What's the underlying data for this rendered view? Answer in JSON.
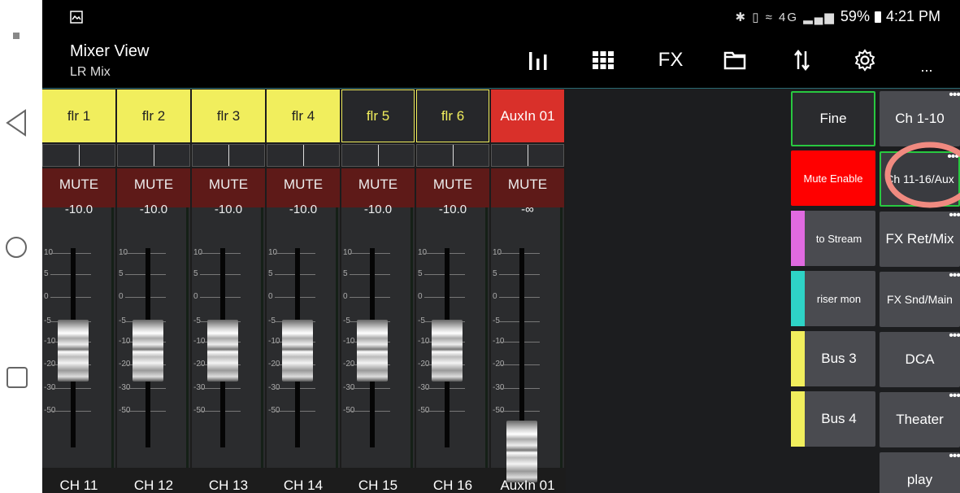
{
  "status_bar": {
    "battery": "59%",
    "time": "4:21 PM",
    "icons": "✱ ▯ ≈ 4G ▂▄▆"
  },
  "app_bar": {
    "title": "Mixer View",
    "subtitle": "LR Mix",
    "fx_label": "FX",
    "more_label": "..."
  },
  "fader_scale": [
    "10",
    "5",
    "0",
    "-5",
    "-10",
    "-20",
    "-30",
    "-50"
  ],
  "channels": [
    {
      "scribble": "flr 1",
      "mute": "MUTE",
      "db": "-10.0",
      "name": "CH 11",
      "color": "#f1ee5d",
      "text_color": "#222222",
      "outlined": false,
      "level": 0.56
    },
    {
      "scribble": "flr 2",
      "mute": "MUTE",
      "db": "-10.0",
      "name": "CH 12",
      "color": "#f1ee5d",
      "text_color": "#222222",
      "outlined": false,
      "level": 0.56
    },
    {
      "scribble": "flr 3",
      "mute": "MUTE",
      "db": "-10.0",
      "name": "CH 13",
      "color": "#f1ee5d",
      "text_color": "#222222",
      "outlined": false,
      "level": 0.56
    },
    {
      "scribble": "flr 4",
      "mute": "MUTE",
      "db": "-10.0",
      "name": "CH 14",
      "color": "#f1ee5d",
      "text_color": "#222222",
      "outlined": false,
      "level": 0.56
    },
    {
      "scribble": "flr 5",
      "mute": "MUTE",
      "db": "-10.0",
      "name": "CH 15",
      "color": "#26272a",
      "text_color": "#f1ee5d",
      "outlined": true,
      "level": 0.56
    },
    {
      "scribble": "flr 6",
      "mute": "MUTE",
      "db": "-10.0",
      "name": "CH 16",
      "color": "#26272a",
      "text_color": "#f1ee5d",
      "outlined": true,
      "level": 0.56
    },
    {
      "scribble": "AuxIn 01",
      "mute": "MUTE",
      "db": "-∞",
      "name": "AuxIn 01",
      "color": "#d9302a",
      "text_color": "#ffffff",
      "outlined": false,
      "level": 0.0
    }
  ],
  "right_panel": {
    "fine": "Fine",
    "mute_enable": "Mute Enable",
    "to_stream": "to Stream",
    "riser_mon": "riser mon",
    "bus3": "Bus 3",
    "bus4": "Bus 4",
    "layers": [
      "Ch 1-10",
      "Ch 11-16/Aux",
      "FX Ret/Mix",
      "FX Snd/Main",
      "DCA",
      "Theater",
      "play"
    ],
    "colors": {
      "to_stream": "#e06ae0",
      "riser_mon": "#2ed3c6",
      "bus3": "#f1ee5d",
      "bus4": "#f1ee5d",
      "mute_enable": "#ff0000",
      "active_border": "#28c840",
      "highlight_circle": "#f08a80"
    }
  }
}
